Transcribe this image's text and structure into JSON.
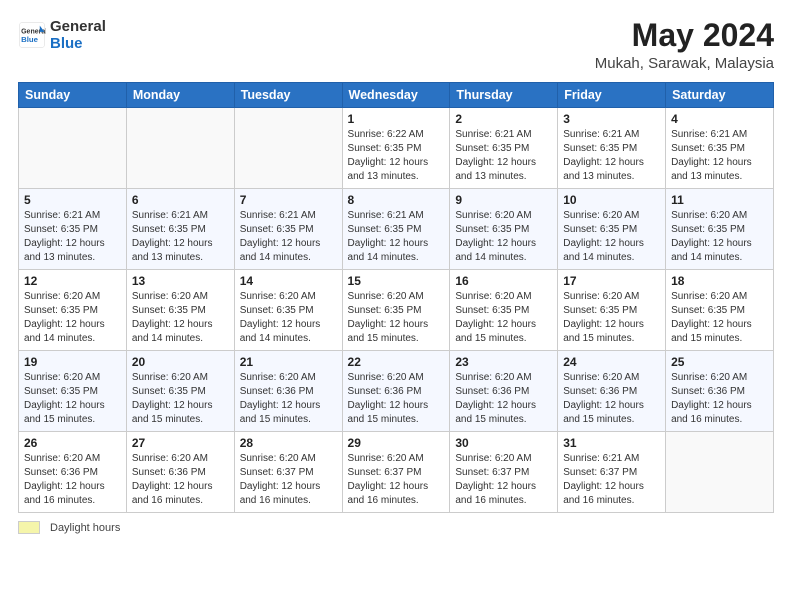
{
  "header": {
    "logo_line1": "General",
    "logo_line2": "Blue",
    "month": "May 2024",
    "location": "Mukah, Sarawak, Malaysia"
  },
  "days_of_week": [
    "Sunday",
    "Monday",
    "Tuesday",
    "Wednesday",
    "Thursday",
    "Friday",
    "Saturday"
  ],
  "weeks": [
    [
      {
        "day": "",
        "info": ""
      },
      {
        "day": "",
        "info": ""
      },
      {
        "day": "",
        "info": ""
      },
      {
        "day": "1",
        "info": "Sunrise: 6:22 AM\nSunset: 6:35 PM\nDaylight: 12 hours\nand 13 minutes."
      },
      {
        "day": "2",
        "info": "Sunrise: 6:21 AM\nSunset: 6:35 PM\nDaylight: 12 hours\nand 13 minutes."
      },
      {
        "day": "3",
        "info": "Sunrise: 6:21 AM\nSunset: 6:35 PM\nDaylight: 12 hours\nand 13 minutes."
      },
      {
        "day": "4",
        "info": "Sunrise: 6:21 AM\nSunset: 6:35 PM\nDaylight: 12 hours\nand 13 minutes."
      }
    ],
    [
      {
        "day": "5",
        "info": "Sunrise: 6:21 AM\nSunset: 6:35 PM\nDaylight: 12 hours\nand 13 minutes."
      },
      {
        "day": "6",
        "info": "Sunrise: 6:21 AM\nSunset: 6:35 PM\nDaylight: 12 hours\nand 13 minutes."
      },
      {
        "day": "7",
        "info": "Sunrise: 6:21 AM\nSunset: 6:35 PM\nDaylight: 12 hours\nand 14 minutes."
      },
      {
        "day": "8",
        "info": "Sunrise: 6:21 AM\nSunset: 6:35 PM\nDaylight: 12 hours\nand 14 minutes."
      },
      {
        "day": "9",
        "info": "Sunrise: 6:20 AM\nSunset: 6:35 PM\nDaylight: 12 hours\nand 14 minutes."
      },
      {
        "day": "10",
        "info": "Sunrise: 6:20 AM\nSunset: 6:35 PM\nDaylight: 12 hours\nand 14 minutes."
      },
      {
        "day": "11",
        "info": "Sunrise: 6:20 AM\nSunset: 6:35 PM\nDaylight: 12 hours\nand 14 minutes."
      }
    ],
    [
      {
        "day": "12",
        "info": "Sunrise: 6:20 AM\nSunset: 6:35 PM\nDaylight: 12 hours\nand 14 minutes."
      },
      {
        "day": "13",
        "info": "Sunrise: 6:20 AM\nSunset: 6:35 PM\nDaylight: 12 hours\nand 14 minutes."
      },
      {
        "day": "14",
        "info": "Sunrise: 6:20 AM\nSunset: 6:35 PM\nDaylight: 12 hours\nand 14 minutes."
      },
      {
        "day": "15",
        "info": "Sunrise: 6:20 AM\nSunset: 6:35 PM\nDaylight: 12 hours\nand 15 minutes."
      },
      {
        "day": "16",
        "info": "Sunrise: 6:20 AM\nSunset: 6:35 PM\nDaylight: 12 hours\nand 15 minutes."
      },
      {
        "day": "17",
        "info": "Sunrise: 6:20 AM\nSunset: 6:35 PM\nDaylight: 12 hours\nand 15 minutes."
      },
      {
        "day": "18",
        "info": "Sunrise: 6:20 AM\nSunset: 6:35 PM\nDaylight: 12 hours\nand 15 minutes."
      }
    ],
    [
      {
        "day": "19",
        "info": "Sunrise: 6:20 AM\nSunset: 6:35 PM\nDaylight: 12 hours\nand 15 minutes."
      },
      {
        "day": "20",
        "info": "Sunrise: 6:20 AM\nSunset: 6:35 PM\nDaylight: 12 hours\nand 15 minutes."
      },
      {
        "day": "21",
        "info": "Sunrise: 6:20 AM\nSunset: 6:36 PM\nDaylight: 12 hours\nand 15 minutes."
      },
      {
        "day": "22",
        "info": "Sunrise: 6:20 AM\nSunset: 6:36 PM\nDaylight: 12 hours\nand 15 minutes."
      },
      {
        "day": "23",
        "info": "Sunrise: 6:20 AM\nSunset: 6:36 PM\nDaylight: 12 hours\nand 15 minutes."
      },
      {
        "day": "24",
        "info": "Sunrise: 6:20 AM\nSunset: 6:36 PM\nDaylight: 12 hours\nand 15 minutes."
      },
      {
        "day": "25",
        "info": "Sunrise: 6:20 AM\nSunset: 6:36 PM\nDaylight: 12 hours\nand 16 minutes."
      }
    ],
    [
      {
        "day": "26",
        "info": "Sunrise: 6:20 AM\nSunset: 6:36 PM\nDaylight: 12 hours\nand 16 minutes."
      },
      {
        "day": "27",
        "info": "Sunrise: 6:20 AM\nSunset: 6:36 PM\nDaylight: 12 hours\nand 16 minutes."
      },
      {
        "day": "28",
        "info": "Sunrise: 6:20 AM\nSunset: 6:37 PM\nDaylight: 12 hours\nand 16 minutes."
      },
      {
        "day": "29",
        "info": "Sunrise: 6:20 AM\nSunset: 6:37 PM\nDaylight: 12 hours\nand 16 minutes."
      },
      {
        "day": "30",
        "info": "Sunrise: 6:20 AM\nSunset: 6:37 PM\nDaylight: 12 hours\nand 16 minutes."
      },
      {
        "day": "31",
        "info": "Sunrise: 6:21 AM\nSunset: 6:37 PM\nDaylight: 12 hours\nand 16 minutes."
      },
      {
        "day": "",
        "info": ""
      }
    ]
  ],
  "footer": {
    "legend_label": "Daylight hours"
  }
}
